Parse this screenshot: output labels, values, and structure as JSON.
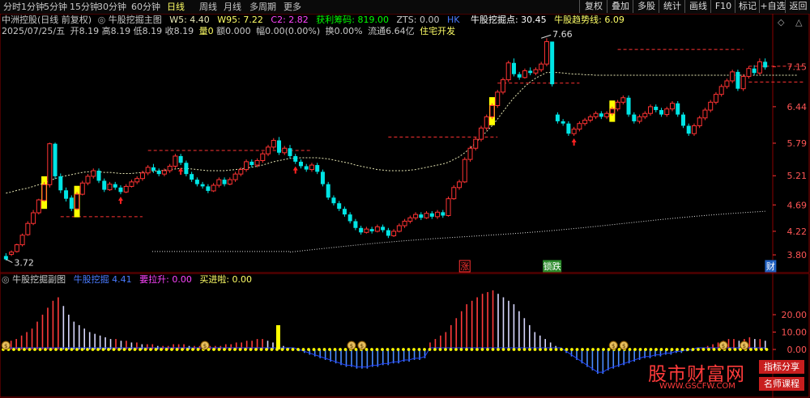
{
  "toolbar": {
    "periods": [
      "分时",
      "1分钟",
      "5分钟",
      "15分钟",
      "30分钟",
      "60分钟",
      "日线",
      "周线",
      "月线",
      "多周期",
      "更多"
    ],
    "buttons": [
      "复权",
      "叠加",
      "多股",
      "统计",
      "画线",
      "F10",
      "标记",
      "+自选",
      "返回"
    ]
  },
  "header": {
    "title": "中洲控股(日线 前复权)",
    "indicator_name": "牛股挖掘主图",
    "w5_label": "W5:",
    "w5_value": "4.40",
    "w95_label": "W95:",
    "w95_value": "7.22",
    "c2_label": "C2:",
    "c2_value": "2.82",
    "chip_label": "获利筹码:",
    "chip_value": "819.00",
    "zts_label": "ZTS:",
    "zts_value": "0.00",
    "hk_label": "HK",
    "dig_label": "牛股挖掘点:",
    "dig_value": "30.45",
    "trend_label": "牛股趋势线:",
    "trend_value": "6.09"
  },
  "quote": {
    "date": "2025/07/25/五",
    "open": "开8.19",
    "high": "高8.19",
    "low": "低8.19",
    "close": "收8.19",
    "volume": "量0",
    "amount": "额0.000",
    "range": "幅0.00(0.00%)",
    "turnover": "换0.00%",
    "float": "流通6.64亿",
    "sector": "住宅开发"
  },
  "price_axis": [
    "7.15",
    "6.44",
    "5.79",
    "5.21",
    "4.69",
    "4.22",
    "3.80"
  ],
  "price_range": [
    3.72,
    7.66
  ],
  "annotations": {
    "high_marker": "7.66",
    "low_marker": "3.72"
  },
  "signals": [
    {
      "text": "涨"
    },
    {
      "text": "锁跌"
    },
    {
      "text": "财"
    }
  ],
  "sub_chart": {
    "title": "牛股挖掘副图",
    "indicator_label": "牛股挖掘",
    "indicator_value": "4.41",
    "pull_label": "要拉升:",
    "pull_value": "0.00",
    "buy_label": "买进啦:",
    "buy_value": "0.00",
    "axis": [
      "20.00",
      "10.00",
      "0.00"
    ]
  },
  "watermark": {
    "brand": "股市财富网",
    "url": "WWW.GSCFW.COM",
    "tag1": "指标分享",
    "tag2": "名师课程"
  },
  "colors": {
    "up": "#ff3333",
    "down": "#00e5e5",
    "yellow_bar": "#ffff00",
    "ma_line": "#e6e6b4",
    "support": "#ff3333",
    "grid_red": "#8b0000",
    "label_gray": "#c8c8c8",
    "magenta": "#ff00ff",
    "blue_value": "#4a7bff",
    "green_value": "#00ff00",
    "watermark_brand": "#ff3b3b"
  },
  "chart_data": {
    "type": "candlestick",
    "candles": [
      [
        3.78,
        3.72,
        3.7,
        3.83
      ],
      [
        3.81,
        3.85,
        3.78,
        3.88
      ],
      [
        3.86,
        3.98,
        3.84,
        4.0
      ],
      [
        3.98,
        4.15,
        3.95,
        4.18
      ],
      [
        4.16,
        4.36,
        4.14,
        4.4
      ],
      [
        4.36,
        4.55,
        4.33,
        4.6
      ],
      [
        4.55,
        4.78,
        4.52,
        4.8
      ],
      [
        4.77,
        5.05,
        4.75,
        5.1
      ],
      [
        5.05,
        5.78,
        5.0,
        5.8
      ],
      [
        5.78,
        5.2,
        5.15,
        5.8
      ],
      [
        5.2,
        4.95,
        4.9,
        5.25
      ],
      [
        4.95,
        4.8,
        4.75,
        5.0
      ],
      [
        4.82,
        4.62,
        4.58,
        4.86
      ],
      [
        4.62,
        4.88,
        4.6,
        4.92
      ],
      [
        4.88,
        5.08,
        4.86,
        5.12
      ],
      [
        5.08,
        5.2,
        5.04,
        5.24
      ],
      [
        5.2,
        5.3,
        5.16,
        5.34
      ],
      [
        5.3,
        5.12,
        5.08,
        5.34
      ],
      [
        5.12,
        4.96,
        4.92,
        5.16
      ],
      [
        4.96,
        5.06,
        4.94,
        5.1
      ],
      [
        5.06,
        5.0,
        4.96,
        5.1
      ],
      [
        5.0,
        4.92,
        4.88,
        5.04
      ],
      [
        4.92,
        5.02,
        4.9,
        5.06
      ],
      [
        5.02,
        5.1,
        5.0,
        5.14
      ],
      [
        5.1,
        5.16,
        5.06,
        5.2
      ],
      [
        5.16,
        5.26,
        5.12,
        5.3
      ],
      [
        5.26,
        5.36,
        5.22,
        5.4
      ],
      [
        5.36,
        5.3,
        5.26,
        5.42
      ],
      [
        5.3,
        5.24,
        5.2,
        5.34
      ],
      [
        5.24,
        5.3,
        5.2,
        5.34
      ],
      [
        5.3,
        5.38,
        5.26,
        5.42
      ],
      [
        5.38,
        5.56,
        5.34,
        5.6
      ],
      [
        5.56,
        5.44,
        5.4,
        5.6
      ],
      [
        5.44,
        5.24,
        5.2,
        5.48
      ],
      [
        5.24,
        5.14,
        5.1,
        5.28
      ],
      [
        5.14,
        5.06,
        5.02,
        5.18
      ],
      [
        5.06,
        5.02,
        4.98,
        5.1
      ],
      [
        5.02,
        4.94,
        4.9,
        5.06
      ],
      [
        4.94,
        5.04,
        4.92,
        5.08
      ],
      [
        5.04,
        5.14,
        5.0,
        5.18
      ],
      [
        5.14,
        5.06,
        5.02,
        5.18
      ],
      [
        5.06,
        5.14,
        5.04,
        5.18
      ],
      [
        5.14,
        5.24,
        5.1,
        5.28
      ],
      [
        5.24,
        5.32,
        5.2,
        5.36
      ],
      [
        5.32,
        5.46,
        5.28,
        5.5
      ],
      [
        5.46,
        5.4,
        5.36,
        5.5
      ],
      [
        5.4,
        5.48,
        5.36,
        5.52
      ],
      [
        5.48,
        5.6,
        5.44,
        5.64
      ],
      [
        5.6,
        5.72,
        5.56,
        5.76
      ],
      [
        5.72,
        5.84,
        5.68,
        5.88
      ],
      [
        5.84,
        5.62,
        5.58,
        5.9
      ],
      [
        5.62,
        5.7,
        5.58,
        5.74
      ],
      [
        5.7,
        5.56,
        5.52,
        5.76
      ],
      [
        5.56,
        5.46,
        5.42,
        5.6
      ],
      [
        5.46,
        5.38,
        5.34,
        5.5
      ],
      [
        5.38,
        5.32,
        5.28,
        5.42
      ],
      [
        5.32,
        5.4,
        5.28,
        5.44
      ],
      [
        5.4,
        5.28,
        5.24,
        5.44
      ],
      [
        5.28,
        5.06,
        5.02,
        5.32
      ],
      [
        5.06,
        4.82,
        4.78,
        5.1
      ],
      [
        4.82,
        4.72,
        4.68,
        4.86
      ],
      [
        4.72,
        4.62,
        4.58,
        4.76
      ],
      [
        4.62,
        4.52,
        4.48,
        4.66
      ],
      [
        4.52,
        4.4,
        4.36,
        4.56
      ],
      [
        4.4,
        4.28,
        4.24,
        4.44
      ],
      [
        4.28,
        4.2,
        4.16,
        4.32
      ],
      [
        4.2,
        4.26,
        4.18,
        4.3
      ],
      [
        4.26,
        4.22,
        4.18,
        4.3
      ],
      [
        4.22,
        4.3,
        4.2,
        4.34
      ],
      [
        4.3,
        4.24,
        4.2,
        4.34
      ],
      [
        4.24,
        4.14,
        4.1,
        4.28
      ],
      [
        4.14,
        4.22,
        4.12,
        4.26
      ],
      [
        4.22,
        4.32,
        4.2,
        4.36
      ],
      [
        4.32,
        4.4,
        4.28,
        4.44
      ],
      [
        4.4,
        4.46,
        4.36,
        4.5
      ],
      [
        4.46,
        4.52,
        4.42,
        4.56
      ],
      [
        4.52,
        4.46,
        4.42,
        4.56
      ],
      [
        4.46,
        4.54,
        4.44,
        4.58
      ],
      [
        4.54,
        4.48,
        4.44,
        4.58
      ],
      [
        4.48,
        4.56,
        4.44,
        4.6
      ],
      [
        4.56,
        4.5,
        4.46,
        4.6
      ],
      [
        4.5,
        4.8,
        4.48,
        4.84
      ],
      [
        4.8,
        5.0,
        4.78,
        5.04
      ],
      [
        5.0,
        5.1,
        4.96,
        5.14
      ],
      [
        5.1,
        5.5,
        5.08,
        5.54
      ],
      [
        5.5,
        5.7,
        5.46,
        5.74
      ],
      [
        5.7,
        5.86,
        5.66,
        5.9
      ],
      [
        5.86,
        6.06,
        5.82,
        6.1
      ],
      [
        6.06,
        6.26,
        6.02,
        6.3
      ],
      [
        6.26,
        6.46,
        6.22,
        6.5
      ],
      [
        6.46,
        6.7,
        6.42,
        6.74
      ],
      [
        6.7,
        6.92,
        6.66,
        6.96
      ],
      [
        6.92,
        7.22,
        6.88,
        7.26
      ],
      [
        7.22,
        7.02,
        6.98,
        7.3
      ],
      [
        7.02,
        6.96,
        6.92,
        7.06
      ],
      [
        6.96,
        7.08,
        6.94,
        7.12
      ],
      [
        7.08,
        7.04,
        7.0,
        7.14
      ],
      [
        7.04,
        7.1,
        7.0,
        7.14
      ],
      [
        7.1,
        7.2,
        7.06,
        7.24
      ],
      [
        7.2,
        7.6,
        7.16,
        7.66
      ],
      [
        7.6,
        6.84,
        6.8,
        7.6
      ],
      [
        6.3,
        6.18,
        6.14,
        6.34
      ],
      [
        6.18,
        6.14,
        6.1,
        6.22
      ],
      [
        6.14,
        5.96,
        5.92,
        6.18
      ],
      [
        5.96,
        6.04,
        5.92,
        6.08
      ],
      [
        6.04,
        6.14,
        6.0,
        6.18
      ],
      [
        6.14,
        6.2,
        6.1,
        6.24
      ],
      [
        6.2,
        6.26,
        6.16,
        6.3
      ],
      [
        6.26,
        6.32,
        6.22,
        6.36
      ],
      [
        6.32,
        6.26,
        6.22,
        6.36
      ],
      [
        6.26,
        6.32,
        6.22,
        6.36
      ],
      [
        6.32,
        6.4,
        6.28,
        6.44
      ],
      [
        6.4,
        6.52,
        6.36,
        6.56
      ],
      [
        6.52,
        6.6,
        6.48,
        6.64
      ],
      [
        6.6,
        6.3,
        6.26,
        6.64
      ],
      [
        6.3,
        6.18,
        6.14,
        6.34
      ],
      [
        6.18,
        6.26,
        6.14,
        6.3
      ],
      [
        6.26,
        6.32,
        6.22,
        6.36
      ],
      [
        6.32,
        6.44,
        6.28,
        6.48
      ],
      [
        6.44,
        6.38,
        6.34,
        6.48
      ],
      [
        6.38,
        6.3,
        6.26,
        6.42
      ],
      [
        6.3,
        6.4,
        6.26,
        6.44
      ],
      [
        6.4,
        6.5,
        6.36,
        6.54
      ],
      [
        6.5,
        6.3,
        6.26,
        6.54
      ],
      [
        6.3,
        6.1,
        6.06,
        6.34
      ],
      [
        6.1,
        5.96,
        5.92,
        6.14
      ],
      [
        5.96,
        6.1,
        5.92,
        6.14
      ],
      [
        6.1,
        6.24,
        6.06,
        6.28
      ],
      [
        6.24,
        6.38,
        6.2,
        6.42
      ],
      [
        6.38,
        6.52,
        6.34,
        6.56
      ],
      [
        6.52,
        6.66,
        6.48,
        6.7
      ],
      [
        6.66,
        6.8,
        6.62,
        6.84
      ],
      [
        6.8,
        6.9,
        6.76,
        6.94
      ],
      [
        6.9,
        7.06,
        6.86,
        7.1
      ],
      [
        7.06,
        6.76,
        6.72,
        7.1
      ],
      [
        6.76,
        6.98,
        6.72,
        7.02
      ],
      [
        6.98,
        7.12,
        6.94,
        7.16
      ],
      [
        7.12,
        7.04,
        7.0,
        7.18
      ],
      [
        7.04,
        7.24,
        7.0,
        7.3
      ],
      [
        7.24,
        7.14,
        7.1,
        7.3
      ]
    ],
    "ma": [
      4.9,
      4.92,
      4.95,
      4.97,
      4.99,
      5.02,
      5.05,
      5.08,
      5.12,
      5.16,
      5.19,
      5.21,
      5.23,
      5.25,
      5.27,
      5.28,
      5.28,
      5.28,
      5.27,
      5.27,
      5.26,
      5.25,
      5.25,
      5.25,
      5.26,
      5.27,
      5.28,
      5.29,
      5.3,
      5.31,
      5.32,
      5.33,
      5.34,
      5.34,
      5.33,
      5.32,
      5.31,
      5.3,
      5.3,
      5.3,
      5.3,
      5.31,
      5.32,
      5.33,
      5.35,
      5.36,
      5.38,
      5.4,
      5.43,
      5.46,
      5.48,
      5.5,
      5.52,
      5.52,
      5.53,
      5.53,
      5.53,
      5.53,
      5.52,
      5.51,
      5.49,
      5.47,
      5.45,
      5.43,
      5.4,
      5.38,
      5.36,
      5.34,
      5.32,
      5.31,
      5.3,
      5.3,
      5.3,
      5.3,
      5.31,
      5.32,
      5.34,
      5.36,
      5.38,
      5.4,
      5.42,
      5.45,
      5.5,
      5.55,
      5.62,
      5.7,
      5.8,
      5.9,
      6.0,
      6.1,
      6.22,
      6.35,
      6.48,
      6.6,
      6.7,
      6.8,
      6.88,
      6.95,
      7.0,
      7.05,
      7.05,
      7.05,
      7.04,
      7.03,
      7.02,
      7.02,
      7.01,
      7.01,
      7.0,
      7.0,
      7.0,
      7.0,
      7.0,
      7.0,
      7.0,
      7.0,
      7.0,
      7.0,
      7.0,
      7.0,
      7.0,
      7.0,
      7.0,
      7.0,
      7.0,
      7.0,
      7.0,
      7.0,
      7.0,
      7.0,
      7.0,
      7.0,
      7.0,
      7.0,
      7.0,
      7.0,
      7.0,
      7.0,
      7.0,
      7.0,
      7.0,
      7.0,
      7.0,
      7.0,
      7.0,
      7.0
    ],
    "support_lines": [
      {
        "price": 4.48,
        "from": 10,
        "to": 25
      },
      {
        "price": 5.66,
        "from": 26,
        "to": 56
      },
      {
        "price": 5.9,
        "from": 70,
        "to": 90
      },
      {
        "price": 6.86,
        "from": 90,
        "to": 105
      },
      {
        "price": 7.46,
        "from": 112,
        "to": 135
      },
      {
        "price": 7.16,
        "from": 136,
        "to": 146
      },
      {
        "price": 6.88,
        "from": 136,
        "to": 146
      }
    ],
    "sub_values": [
      3,
      5,
      6,
      8,
      10,
      12,
      16,
      20,
      24,
      28,
      30,
      25,
      20,
      16,
      14,
      12,
      10,
      9,
      8,
      7,
      6,
      6,
      5,
      5,
      4,
      4,
      3,
      3,
      3,
      2,
      2,
      2,
      3,
      3,
      3,
      2,
      2,
      2,
      2,
      2,
      2,
      2,
      3,
      3,
      4,
      4,
      5,
      5,
      6,
      6,
      5,
      4,
      3,
      2,
      1,
      0,
      -1,
      -2,
      -3,
      -4,
      -5,
      -6,
      -7,
      -8,
      -9,
      -10,
      -10,
      -11,
      -11,
      -11,
      -10,
      -10,
      -9,
      -9,
      -8,
      -8,
      -7,
      -7,
      -6,
      -6,
      -5,
      4,
      6,
      8,
      10,
      14,
      18,
      22,
      26,
      28,
      30,
      32,
      33,
      34,
      32,
      30,
      28,
      26,
      22,
      18,
      14,
      10,
      8,
      6,
      4,
      2,
      0,
      -2,
      -4,
      -6,
      -8,
      -10,
      -12,
      -14,
      -14,
      -12,
      -11,
      -10,
      -9,
      -8,
      -7,
      -6,
      -5,
      -5,
      -4,
      -4,
      -3,
      -3,
      -2,
      -2,
      -1,
      -1,
      0,
      1,
      2,
      3,
      4,
      5,
      6,
      6,
      5,
      6,
      7,
      6,
      6,
      5
    ]
  }
}
